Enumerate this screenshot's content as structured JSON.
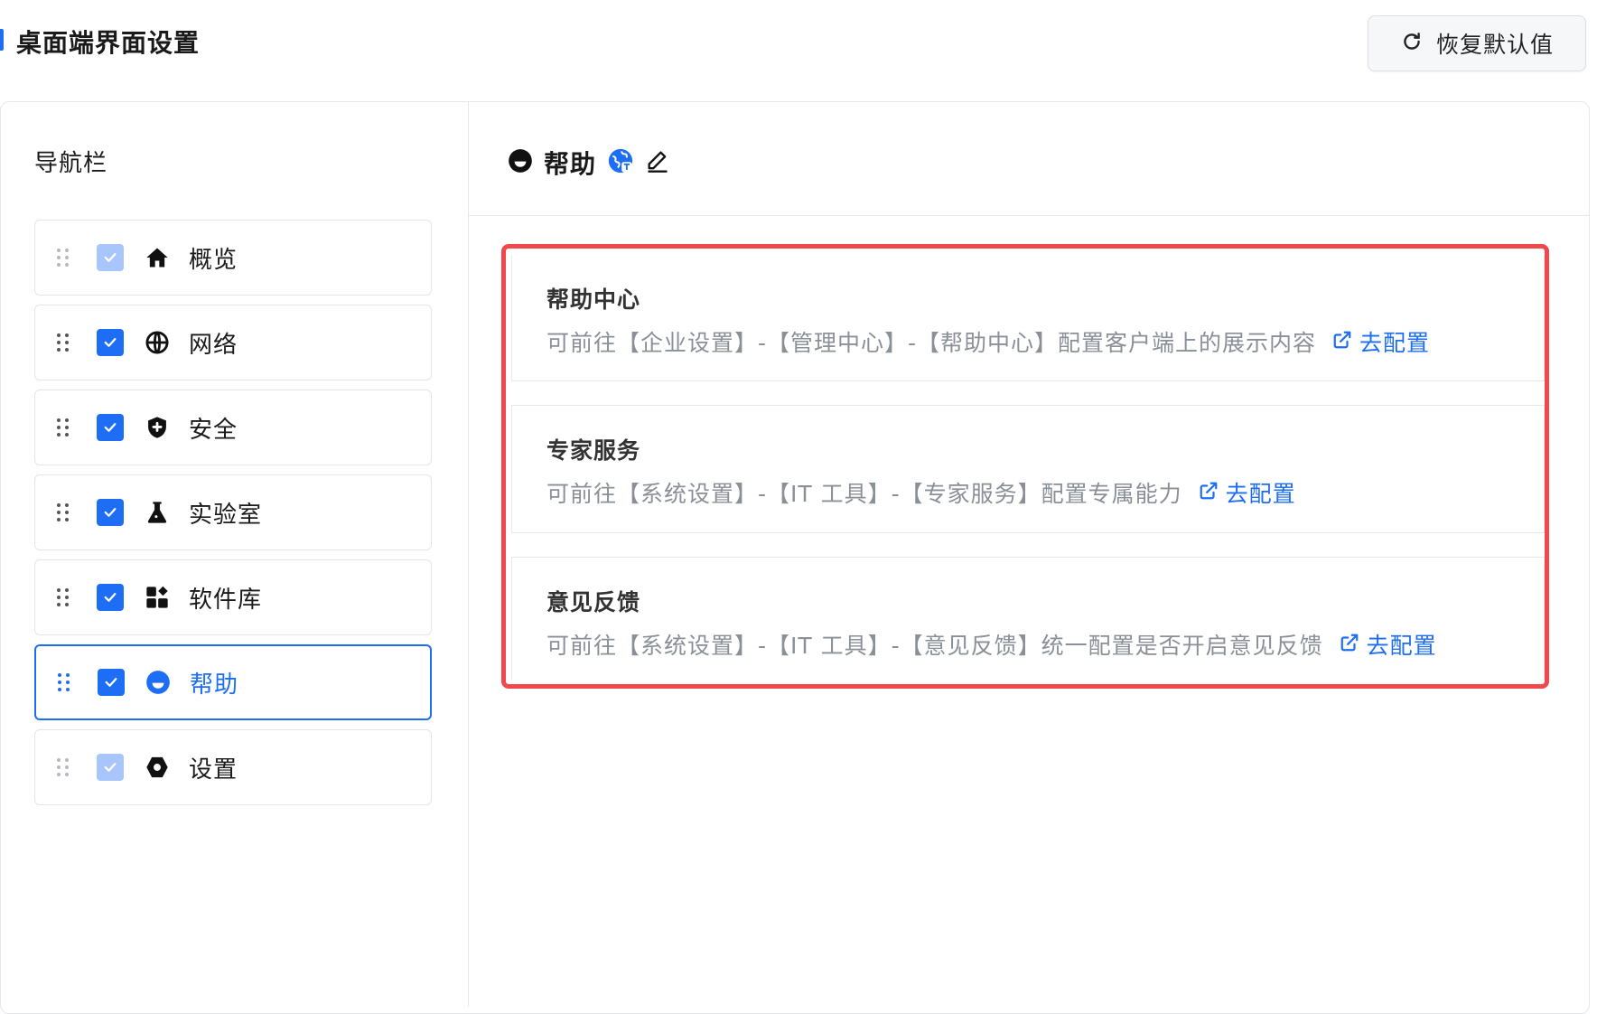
{
  "header": {
    "title": "桌面端界面设置",
    "reset_label": "恢复默认值"
  },
  "nav": {
    "title": "导航栏",
    "items": [
      {
        "label": "概览",
        "icon": "home-icon",
        "checked": true,
        "disabled": true
      },
      {
        "label": "网络",
        "icon": "globe-icon",
        "checked": true,
        "disabled": false
      },
      {
        "label": "安全",
        "icon": "shield-icon",
        "checked": true,
        "disabled": false
      },
      {
        "label": "实验室",
        "icon": "flask-icon",
        "checked": true,
        "disabled": false
      },
      {
        "label": "软件库",
        "icon": "apps-icon",
        "checked": true,
        "disabled": false
      },
      {
        "label": "帮助",
        "icon": "help-icon",
        "checked": true,
        "disabled": false,
        "active": true
      },
      {
        "label": "设置",
        "icon": "gear-icon",
        "checked": true,
        "disabled": true
      }
    ]
  },
  "detail": {
    "title": "帮助",
    "sections": [
      {
        "title": "帮助中心",
        "desc": "可前往【企业设置】-【管理中心】-【帮助中心】配置客户端上的展示内容",
        "link": "去配置"
      },
      {
        "title": "专家服务",
        "desc": "可前往【系统设置】-【IT 工具】-【专家服务】配置专属能力",
        "link": "去配置"
      },
      {
        "title": "意见反馈",
        "desc": "可前往【系统设置】-【IT 工具】-【意见反馈】统一配置是否开启意见反馈",
        "link": "去配置"
      }
    ]
  },
  "colors": {
    "accent": "#1d6ef5",
    "highlight": "#f0484b",
    "muted_text": "#8a8f98"
  }
}
